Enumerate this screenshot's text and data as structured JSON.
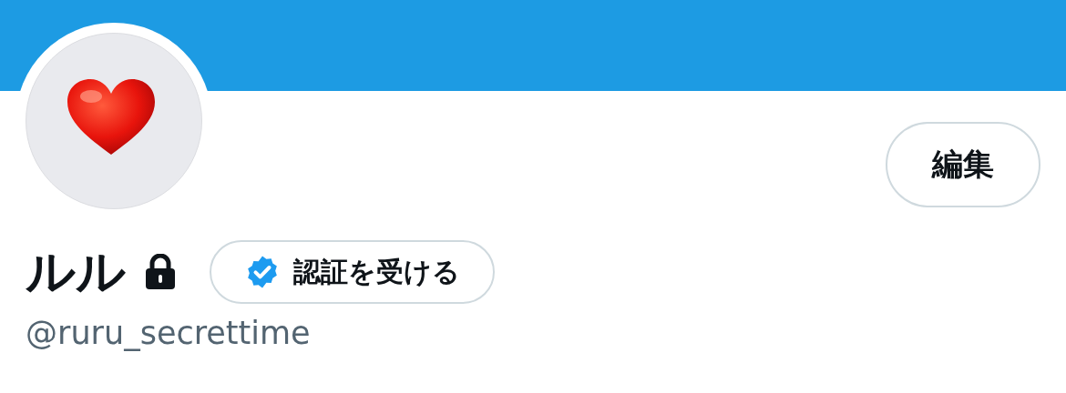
{
  "profile": {
    "name": "ルル",
    "locked": true,
    "handle": "@ruru_secrettime"
  },
  "edit_button": {
    "label": "編集"
  },
  "verify_button": {
    "label": "認証を受ける"
  }
}
